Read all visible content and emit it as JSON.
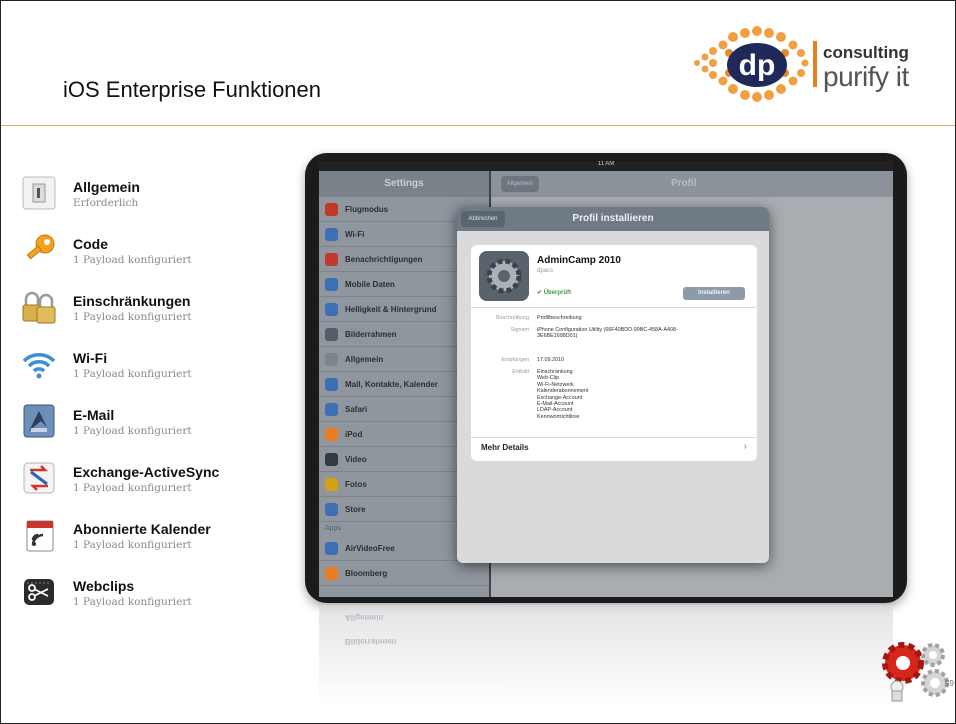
{
  "slide": {
    "title": "iOS Enterprise Funktionen",
    "page_number": "59"
  },
  "logo": {
    "mark": "dp",
    "line1": "consulting",
    "line2": "purify it"
  },
  "payloads": [
    {
      "name": "Allgemein",
      "sub": "Erforderlich",
      "icon": "general-icon"
    },
    {
      "name": "Code",
      "sub": "1 Payload konfiguriert",
      "icon": "key-icon"
    },
    {
      "name": "Einschränkungen",
      "sub": "1 Payload konfiguriert",
      "icon": "locks-icon"
    },
    {
      "name": "Wi-Fi",
      "sub": "1 Payload konfiguriert",
      "icon": "wifi-icon"
    },
    {
      "name": "E-Mail",
      "sub": "1 Payload konfiguriert",
      "icon": "mail-icon"
    },
    {
      "name": "Exchange-ActiveSync",
      "sub": "1 Payload konfiguriert",
      "icon": "exchange-icon"
    },
    {
      "name": "Abonnierte Kalender",
      "sub": "1 Payload konfiguriert",
      "icon": "calendar-icon"
    },
    {
      "name": "Webclips",
      "sub": "1 Payload konfiguriert",
      "icon": "scissors-icon"
    }
  ],
  "ipad": {
    "status_time": "11 AM",
    "sidebar_title": "Settings",
    "sidebar_items": [
      {
        "label": "Flugmodus",
        "color": "#c0392b"
      },
      {
        "label": "Wi-Fi",
        "color": "#3d6fb3"
      },
      {
        "label": "Benachrichtigungen",
        "color": "#c0392b"
      },
      {
        "label": "Mobile Daten",
        "color": "#3d6fb3"
      },
      {
        "label": "Helligkeit & Hintergrund",
        "color": "#3d6fb3"
      },
      {
        "label": "Bilderrahmen",
        "color": "#555e68"
      },
      {
        "label": "Allgemein",
        "color": "#7d848c"
      },
      {
        "label": "Mail, Kontakte, Kalender",
        "color": "#3d6fb3"
      },
      {
        "label": "Safari",
        "color": "#3d6fb3"
      },
      {
        "label": "iPod",
        "color": "#e67e22"
      },
      {
        "label": "Video",
        "color": "#333a40"
      },
      {
        "label": "Fotos",
        "color": "#d4a017"
      },
      {
        "label": "Store",
        "color": "#3d6fb3"
      }
    ],
    "apps_section": "Apps",
    "app_items": [
      {
        "label": "AirVideoFree",
        "color": "#3d6fb3"
      },
      {
        "label": "Bloomberg",
        "color": "#e67e22"
      }
    ],
    "detail_back": "Allgemein",
    "detail_title": "Profil",
    "modal": {
      "cancel": "Abbrechen",
      "title": "Profil installieren",
      "profile_name": "AdminCamp 2010",
      "profile_org": "dpacs",
      "verified": "✔ Überprüft",
      "install": "Installieren",
      "rows": [
        {
          "key": "Beschreibung",
          "value": "Profilbeschreibung"
        },
        {
          "key": "Signiert",
          "value": "iPhone Configuration Utility (66F40BDD-99BC-458A-A408-3E6BE1698D01)"
        },
        {
          "key": "Empfangen",
          "value": "17.09.2010"
        },
        {
          "key": "Enthält",
          "value": "Einschränkung\nWeb-Clip\nWi-Fi-Netzwerk\nKalenderabonnement\nExchange-Account\nE-Mail-Account\nLDAP-Account\nKennwortrichtlinie"
        }
      ],
      "more": "Mehr Details"
    },
    "reflection_items": [
      "Allgemein",
      "Bilderrahmen"
    ]
  }
}
